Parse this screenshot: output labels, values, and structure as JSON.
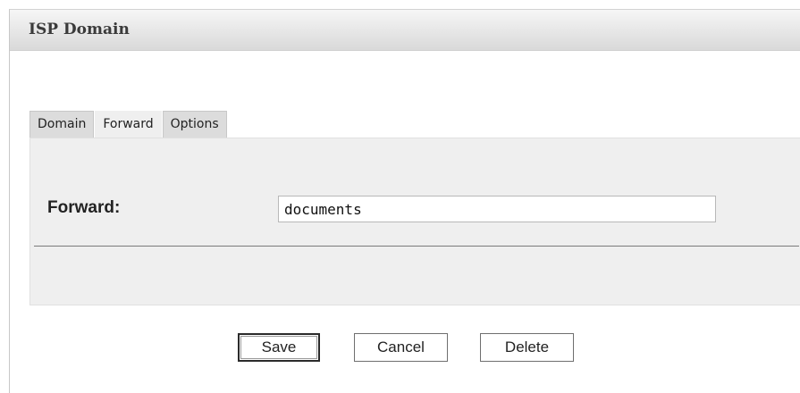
{
  "panel": {
    "title": "ISP Domain"
  },
  "tabs": [
    {
      "label": "Domain",
      "active": false
    },
    {
      "label": "Forward",
      "active": true
    },
    {
      "label": "Options",
      "active": false
    }
  ],
  "form": {
    "forward_label": "Forward:",
    "forward_value": "documents"
  },
  "buttons": {
    "save": "Save",
    "cancel": "Cancel",
    "delete": "Delete"
  }
}
